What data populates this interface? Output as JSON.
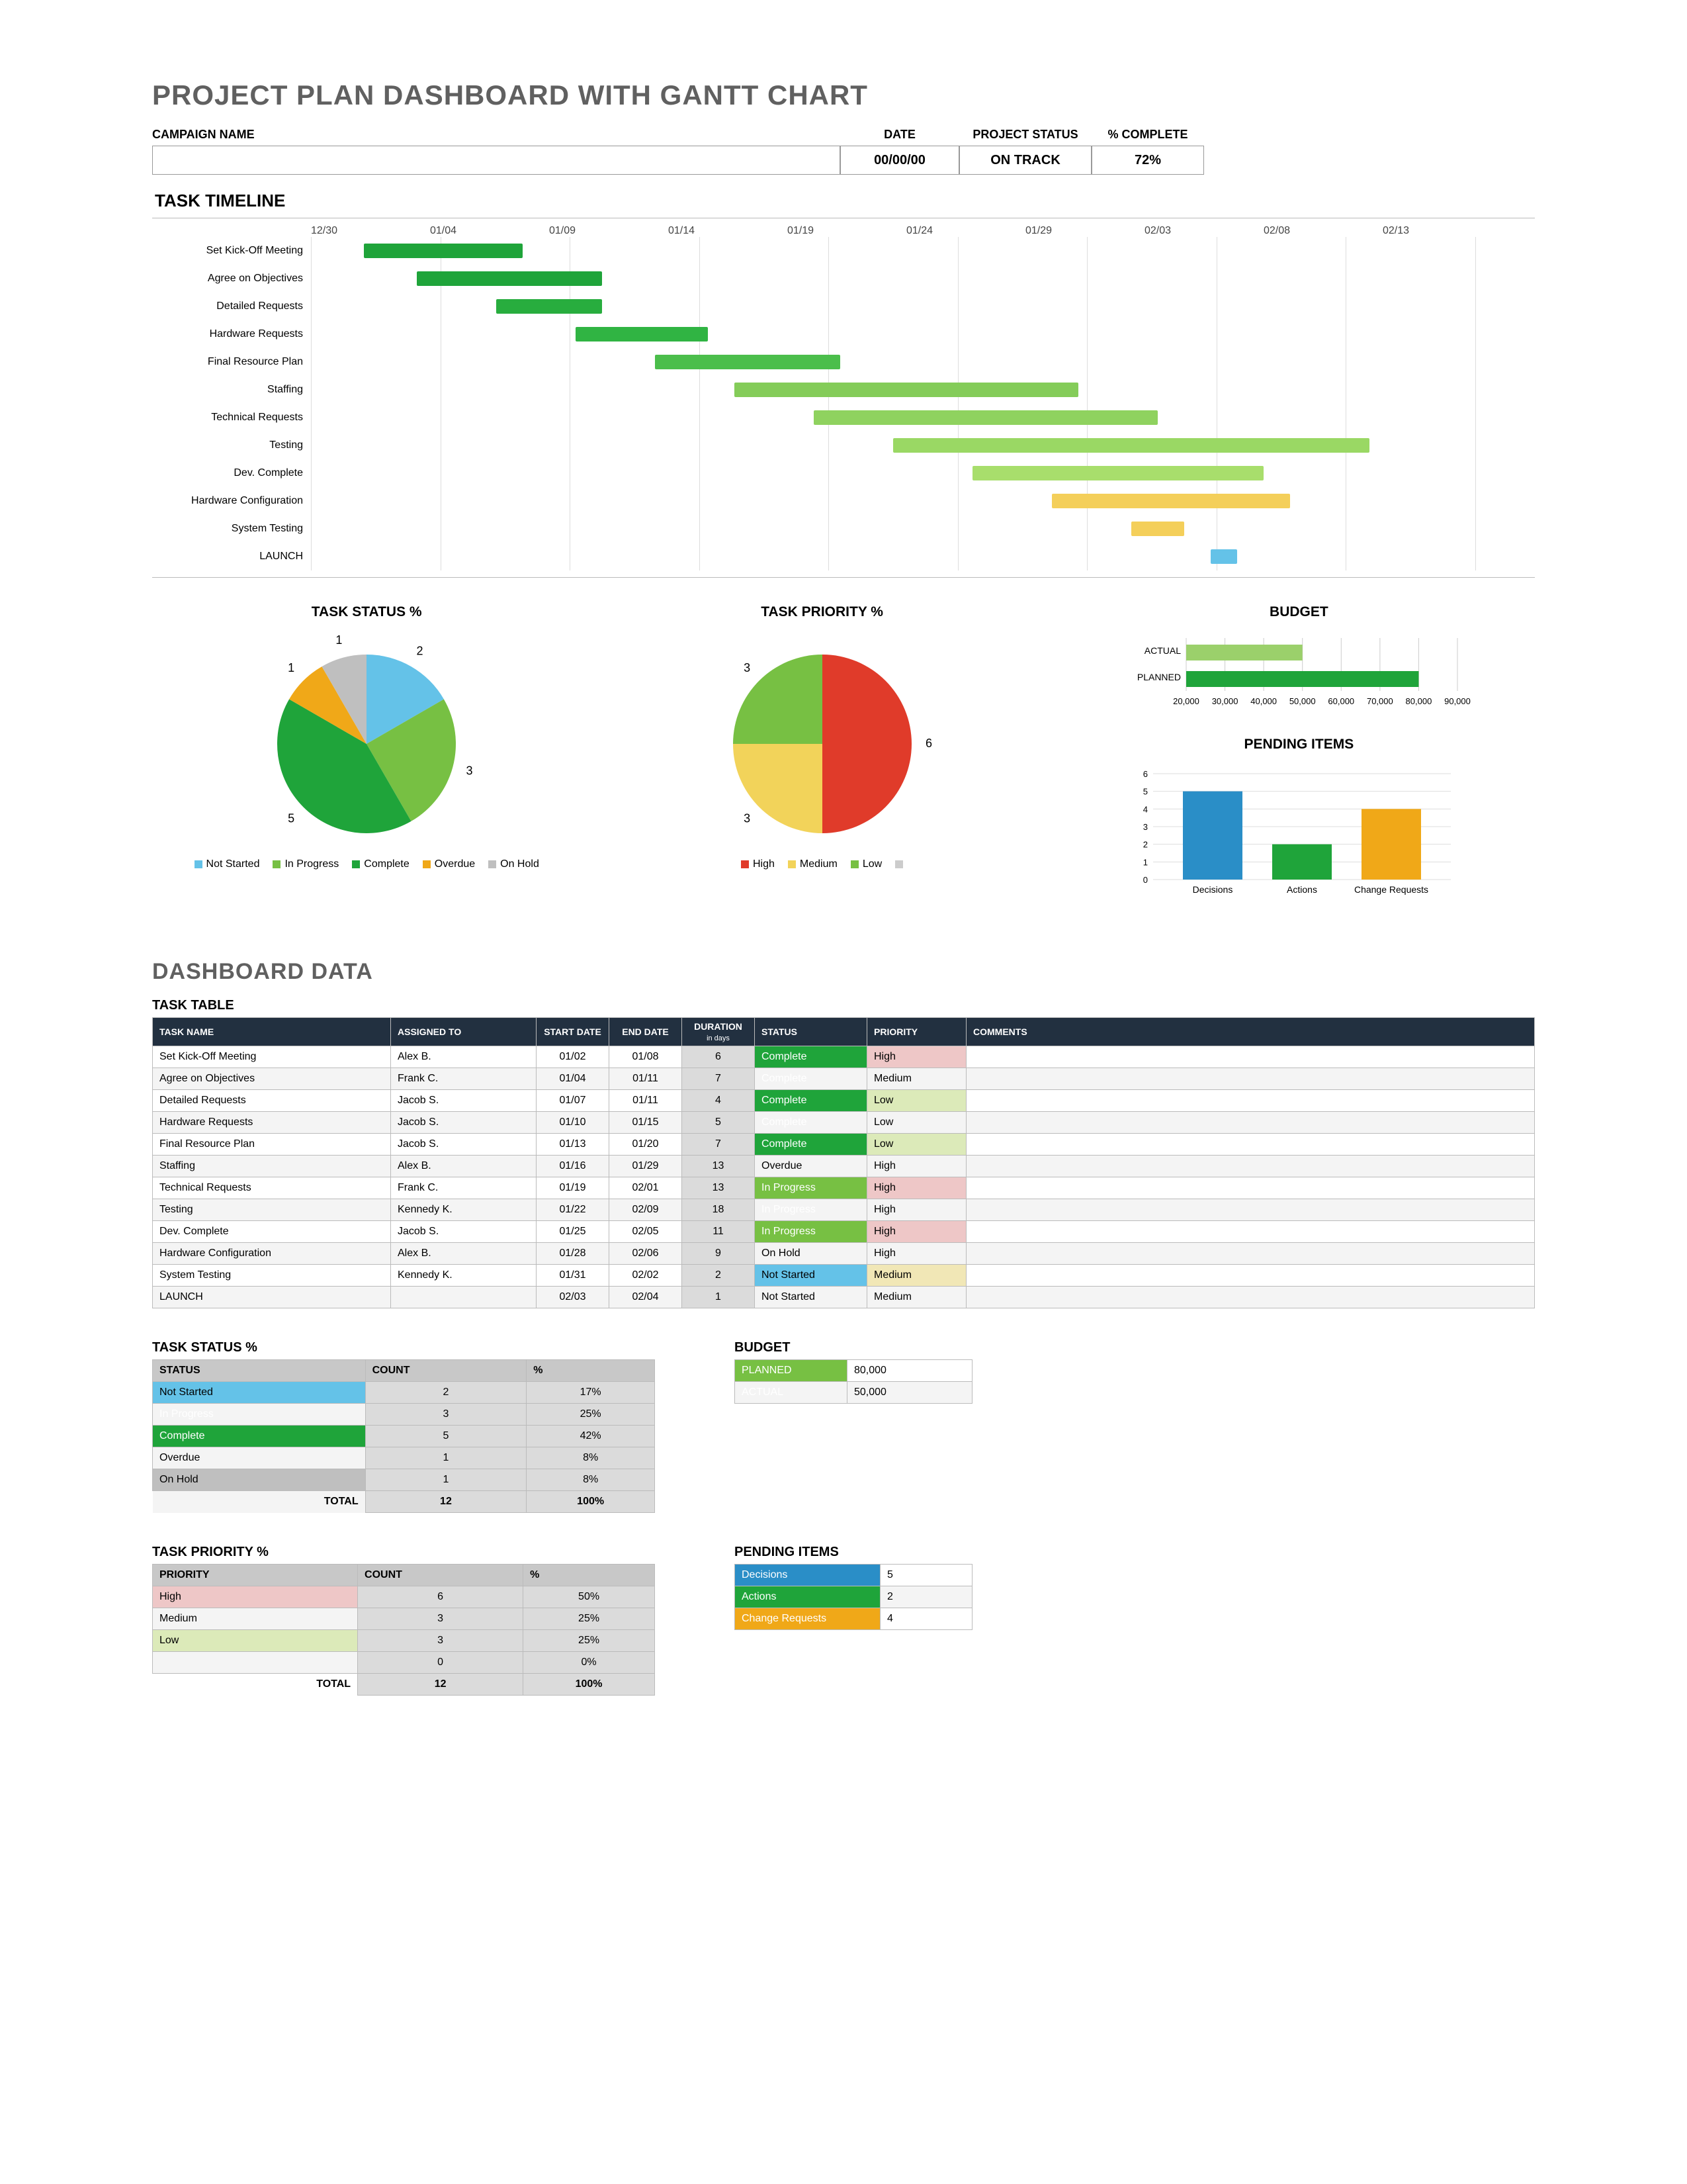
{
  "title": "PROJECT PLAN DASHBOARD WITH GANTT CHART",
  "header": {
    "campaign_label": "CAMPAIGN NAME",
    "campaign_value": "",
    "date_label": "DATE",
    "date_value": "00/00/00",
    "status_label": "PROJECT STATUS",
    "status_value": "ON TRACK",
    "pct_label": "% COMPLETE",
    "pct_value": "72%"
  },
  "gantt": {
    "title": "TASK TIMELINE",
    "ticks": [
      "12/30",
      "01/04",
      "01/09",
      "01/14",
      "01/19",
      "01/24",
      "01/29",
      "02/03",
      "02/08",
      "02/13"
    ],
    "tasks": [
      {
        "name": "Set Kick-Off Meeting",
        "start": "01/02",
        "end": "01/08",
        "color": "#1fa43a"
      },
      {
        "name": "Agree on Objectives",
        "start": "01/04",
        "end": "01/11",
        "color": "#1fa43a"
      },
      {
        "name": "Detailed Requests",
        "start": "01/07",
        "end": "01/11",
        "color": "#28ad3e"
      },
      {
        "name": "Hardware Requests",
        "start": "01/10",
        "end": "01/15",
        "color": "#30b443"
      },
      {
        "name": "Final Resource Plan",
        "start": "01/13",
        "end": "01/20",
        "color": "#4bbe4b"
      },
      {
        "name": "Staffing",
        "start": "01/16",
        "end": "01/29",
        "color": "#84cc59"
      },
      {
        "name": "Technical Requests",
        "start": "01/19",
        "end": "02/01",
        "color": "#8fd25f"
      },
      {
        "name": "Testing",
        "start": "01/22",
        "end": "02/09",
        "color": "#9ad864"
      },
      {
        "name": "Dev. Complete",
        "start": "01/25",
        "end": "02/05",
        "color": "#a8de6c"
      },
      {
        "name": "Hardware Configuration",
        "start": "01/28",
        "end": "02/06",
        "color": "#f4cf5a"
      },
      {
        "name": "System Testing",
        "start": "01/31",
        "end": "02/02",
        "color": "#f4cf5a"
      },
      {
        "name": "LAUNCH",
        "start": "02/03",
        "end": "02/04",
        "color": "#64c2e8"
      }
    ]
  },
  "chart_data": [
    {
      "id": "task_status",
      "type": "pie",
      "title": "TASK STATUS %",
      "series": [
        {
          "name": "Not Started",
          "value": 2,
          "color": "#64c2e8"
        },
        {
          "name": "In Progress",
          "value": 3,
          "color": "#77c043"
        },
        {
          "name": "Complete",
          "value": 5,
          "color": "#1fa43a"
        },
        {
          "name": "Overdue",
          "value": 1,
          "color": "#f0a818"
        },
        {
          "name": "On Hold",
          "value": 1,
          "color": "#bfbfbf"
        }
      ]
    },
    {
      "id": "task_priority",
      "type": "pie",
      "title": "TASK PRIORITY %",
      "series": [
        {
          "name": "High",
          "value": 6,
          "color": "#e03b2a"
        },
        {
          "name": "Medium",
          "value": 3,
          "color": "#f2d35a"
        },
        {
          "name": "Low",
          "value": 3,
          "color": "#77c043"
        },
        {
          "name": "",
          "value": 0,
          "color": "#cccccc"
        }
      ]
    },
    {
      "id": "budget",
      "type": "bar",
      "title": "BUDGET",
      "orientation": "horizontal",
      "categories": [
        "ACTUAL",
        "PLANNED"
      ],
      "values": [
        50000,
        80000
      ],
      "xlim": [
        20000,
        90000
      ],
      "xticks": [
        20000,
        30000,
        40000,
        50000,
        60000,
        70000,
        80000,
        90000
      ],
      "colors": [
        "#9bd06b",
        "#1fa43a"
      ]
    },
    {
      "id": "pending",
      "type": "bar",
      "title": "PENDING ITEMS",
      "categories": [
        "Decisions",
        "Actions",
        "Change Requests"
      ],
      "values": [
        5,
        2,
        4
      ],
      "ylim": [
        0,
        6
      ],
      "yticks": [
        0,
        1,
        2,
        3,
        4,
        5,
        6
      ],
      "colors": [
        "#2a8ec7",
        "#1fa43a",
        "#f0a818"
      ]
    }
  ],
  "dashboard_title": "DASHBOARD DATA",
  "task_table": {
    "title": "TASK TABLE",
    "columns": [
      "TASK NAME",
      "ASSIGNED TO",
      "START DATE",
      "END DATE",
      "DURATION in days",
      "STATUS",
      "PRIORITY",
      "COMMENTS"
    ],
    "rows": [
      {
        "name": "Set Kick-Off Meeting",
        "assigned": "Alex B.",
        "start": "01/02",
        "end": "01/08",
        "dur": "6",
        "status": "Complete",
        "priority": "High",
        "comments": ""
      },
      {
        "name": "Agree on Objectives",
        "assigned": "Frank C.",
        "start": "01/04",
        "end": "01/11",
        "dur": "7",
        "status": "Complete",
        "priority": "Medium",
        "comments": ""
      },
      {
        "name": "Detailed Requests",
        "assigned": "Jacob S.",
        "start": "01/07",
        "end": "01/11",
        "dur": "4",
        "status": "Complete",
        "priority": "Low",
        "comments": ""
      },
      {
        "name": "Hardware Requests",
        "assigned": "Jacob S.",
        "start": "01/10",
        "end": "01/15",
        "dur": "5",
        "status": "Complete",
        "priority": "Low",
        "comments": ""
      },
      {
        "name": "Final Resource Plan",
        "assigned": "Jacob S.",
        "start": "01/13",
        "end": "01/20",
        "dur": "7",
        "status": "Complete",
        "priority": "Low",
        "comments": ""
      },
      {
        "name": "Staffing",
        "assigned": "Alex B.",
        "start": "01/16",
        "end": "01/29",
        "dur": "13",
        "status": "Overdue",
        "priority": "High",
        "comments": ""
      },
      {
        "name": "Technical Requests",
        "assigned": "Frank C.",
        "start": "01/19",
        "end": "02/01",
        "dur": "13",
        "status": "In Progress",
        "priority": "High",
        "comments": ""
      },
      {
        "name": "Testing",
        "assigned": "Kennedy K.",
        "start": "01/22",
        "end": "02/09",
        "dur": "18",
        "status": "In Progress",
        "priority": "High",
        "comments": ""
      },
      {
        "name": "Dev. Complete",
        "assigned": "Jacob S.",
        "start": "01/25",
        "end": "02/05",
        "dur": "11",
        "status": "In Progress",
        "priority": "High",
        "comments": ""
      },
      {
        "name": "Hardware Configuration",
        "assigned": "Alex B.",
        "start": "01/28",
        "end": "02/06",
        "dur": "9",
        "status": "On Hold",
        "priority": "High",
        "comments": ""
      },
      {
        "name": "System Testing",
        "assigned": "Kennedy K.",
        "start": "01/31",
        "end": "02/02",
        "dur": "2",
        "status": "Not Started",
        "priority": "Medium",
        "comments": ""
      },
      {
        "name": "LAUNCH",
        "assigned": "",
        "start": "02/03",
        "end": "02/04",
        "dur": "1",
        "status": "Not Started",
        "priority": "Medium",
        "comments": ""
      }
    ]
  },
  "status_table": {
    "title": "TASK STATUS %",
    "columns": [
      "STATUS",
      "COUNT",
      "%"
    ],
    "rows": [
      {
        "status": "Not Started",
        "count": "2",
        "pct": "17%",
        "cls": "c-notstart"
      },
      {
        "status": "In Progress",
        "count": "3",
        "pct": "25%",
        "cls": "c-inprog"
      },
      {
        "status": "Complete",
        "count": "5",
        "pct": "42%",
        "cls": "c-complete"
      },
      {
        "status": "Overdue",
        "count": "1",
        "pct": "8%",
        "cls": "c-overdue"
      },
      {
        "status": "On Hold",
        "count": "1",
        "pct": "8%",
        "cls": "c-onhold"
      }
    ],
    "total_label": "TOTAL",
    "total_count": "12",
    "total_pct": "100%"
  },
  "budget_table": {
    "title": "BUDGET",
    "rows": [
      {
        "label": "PLANNED",
        "value": "80,000",
        "cls": "c-inprog"
      },
      {
        "label": "ACTUAL",
        "value": "50,000",
        "cls": "c-complete"
      }
    ]
  },
  "priority_table": {
    "title": "TASK PRIORITY %",
    "columns": [
      "PRIORITY",
      "COUNT",
      "%"
    ],
    "rows": [
      {
        "priority": "High",
        "count": "6",
        "pct": "50%",
        "cls": "p-high"
      },
      {
        "priority": "Medium",
        "count": "3",
        "pct": "25%",
        "cls": "p-medium"
      },
      {
        "priority": "Low",
        "count": "3",
        "pct": "25%",
        "cls": "p-low"
      },
      {
        "priority": "",
        "count": "0",
        "pct": "0%",
        "cls": ""
      }
    ],
    "total_label": "TOTAL",
    "total_count": "12",
    "total_pct": "100%"
  },
  "pending_table": {
    "title": "PENDING ITEMS",
    "rows": [
      {
        "label": "Decisions",
        "value": "5",
        "bg": "#2a8ec7"
      },
      {
        "label": "Actions",
        "value": "2",
        "bg": "#1fa43a"
      },
      {
        "label": "Change Requests",
        "value": "4",
        "bg": "#f0a818"
      }
    ]
  }
}
